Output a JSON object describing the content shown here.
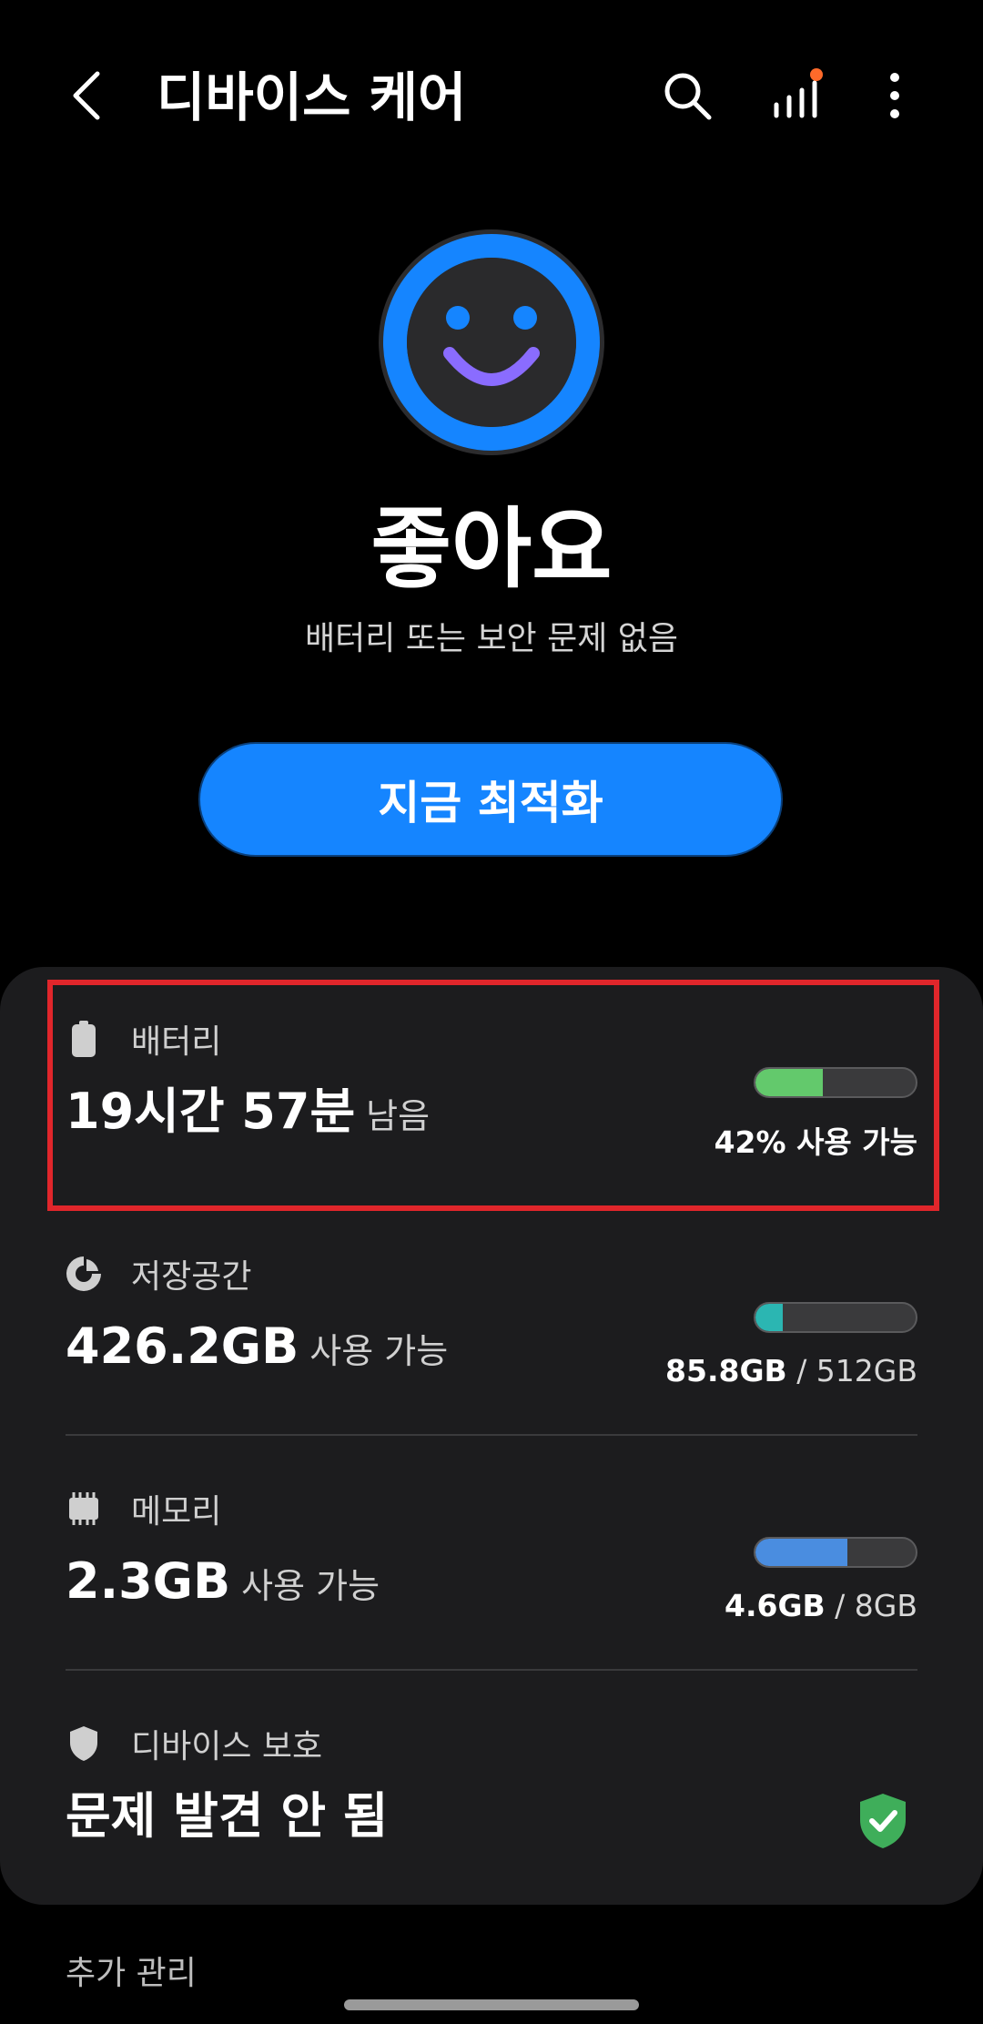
{
  "app_bar": {
    "title": "디바이스 케어",
    "icons": {
      "back": "chevron-left-icon",
      "search": "search-icon",
      "stats": "signal-bars-icon",
      "more": "more-vertical-icon"
    },
    "notification_dot_color": "#ff6a2a"
  },
  "status": {
    "face_icon": "smile-face-icon",
    "title": "좋아요",
    "subtitle": "배터리 또는 보안 문제 없음",
    "ring_color": "#1585ff",
    "smile_color": "#8a6cff"
  },
  "optimize_button": {
    "label": "지금 최적화",
    "color": "#1585ff"
  },
  "battery": {
    "icon": "battery-icon",
    "label": "배터리",
    "value": "19시간 57분",
    "value_suffix": "남음",
    "bar_level": 0.42,
    "bar_color": "#63c96c",
    "caption": "42% 사용 가능"
  },
  "storage": {
    "icon": "storage-pie-icon",
    "label": "저장공간",
    "value": "426.2GB",
    "value_suffix": "사용 가능",
    "bar_level": 0.168,
    "bar_color": "#2bb6b2",
    "caption_used": "85.8GB",
    "caption_total": " / 512GB"
  },
  "memory": {
    "icon": "memory-chip-icon",
    "label": "메모리",
    "value": "2.3GB",
    "value_suffix": "사용 가능",
    "bar_level": 0.575,
    "bar_color": "#4a8de0",
    "caption_used": "4.6GB",
    "caption_total": " / 8GB"
  },
  "device_protection": {
    "icon": "shield-icon",
    "label": "디바이스 보호",
    "value": "문제 발견 안 됨",
    "status_icon": "shield-check-icon",
    "status_color": "#3fae5a"
  },
  "footer": {
    "label": "추가 관리"
  },
  "highlight_color": "#e0262b"
}
